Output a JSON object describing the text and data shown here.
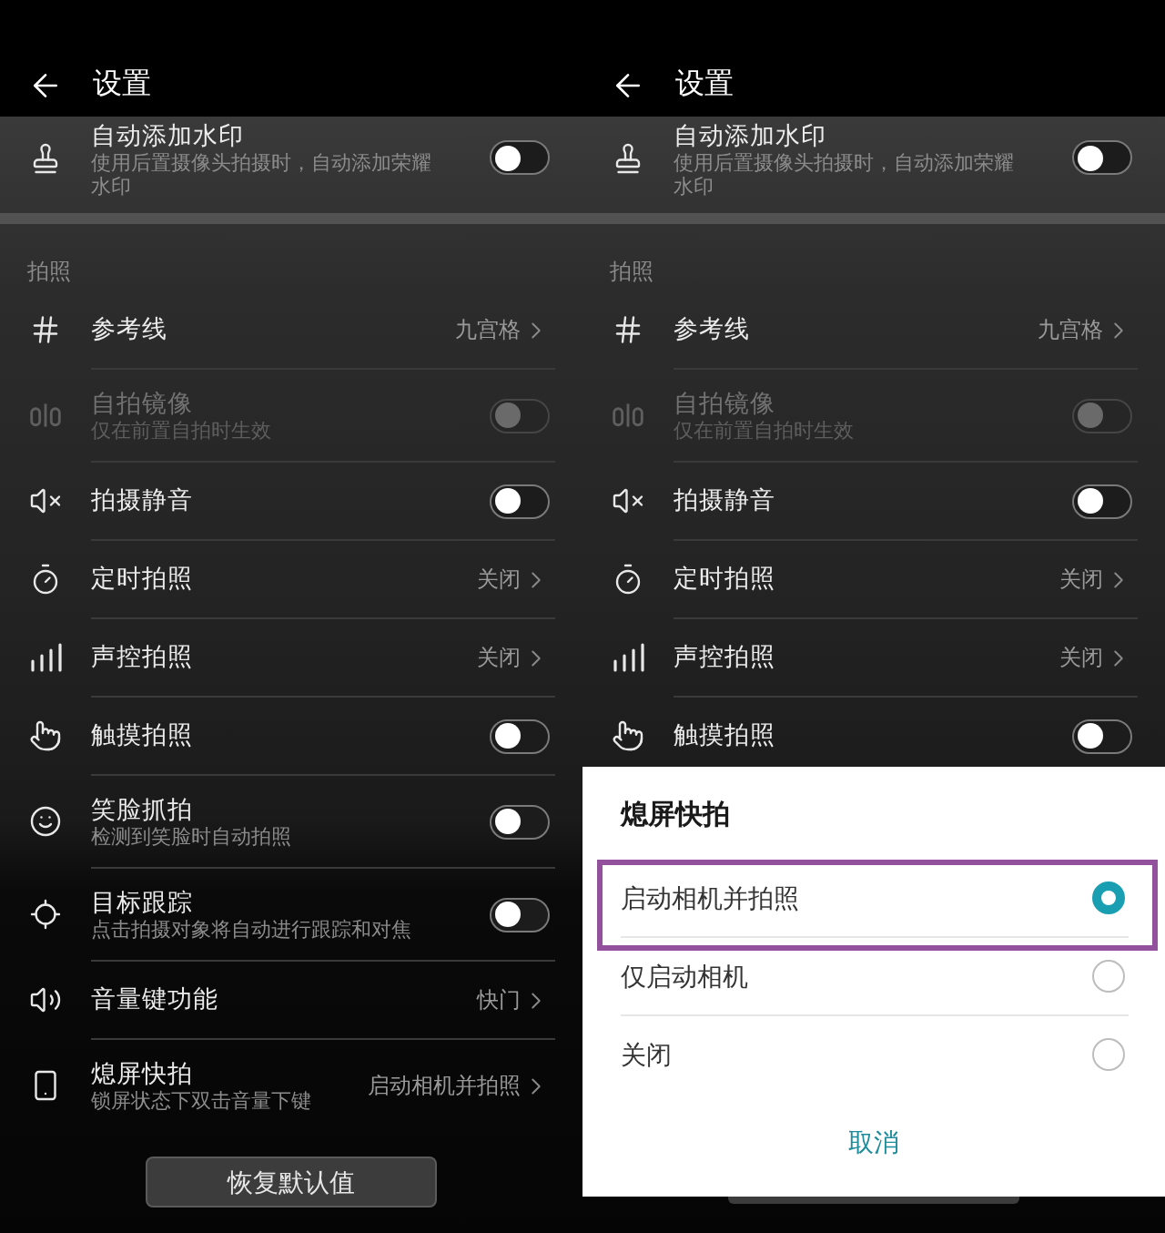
{
  "screens": [
    {
      "header": {
        "title": "设置"
      },
      "top_item": {
        "kind": "toggle",
        "title": "自动添加水印",
        "subtitle": "使用后置摄像头拍摄时，自动添加荣耀水印",
        "on": false,
        "disabled": false
      },
      "section": {
        "title": "拍照",
        "items": [
          {
            "kind": "link",
            "title": "参考线",
            "value": "九宫格",
            "disabled": false
          },
          {
            "kind": "toggle",
            "title": "自拍镜像",
            "subtitle": "仅在前置自拍时生效",
            "on": false,
            "disabled": true
          },
          {
            "kind": "toggle",
            "title": "拍摄静音",
            "on": false,
            "disabled": false
          },
          {
            "kind": "link",
            "title": "定时拍照",
            "value": "关闭",
            "disabled": false
          },
          {
            "kind": "link",
            "title": "声控拍照",
            "value": "关闭",
            "disabled": false
          },
          {
            "kind": "toggle",
            "title": "触摸拍照",
            "on": false,
            "disabled": false
          },
          {
            "kind": "toggle",
            "title": "笑脸抓拍",
            "subtitle": "检测到笑脸时自动拍照",
            "on": false,
            "disabled": false
          },
          {
            "kind": "toggle",
            "title": "目标跟踪",
            "subtitle": "点击拍摄对象将自动进行跟踪和对焦",
            "on": false,
            "disabled": false
          },
          {
            "kind": "link",
            "title": "音量键功能",
            "value": "快门",
            "disabled": false
          },
          {
            "kind": "link",
            "title": "熄屏快拍",
            "subtitle": "锁屏状态下双击音量下键",
            "value": "启动相机并拍照",
            "disabled": false
          }
        ]
      },
      "reset_button": "恢复默认值"
    },
    {
      "header": {
        "title": "设置"
      },
      "top_item": {
        "kind": "toggle",
        "title": "自动添加水印",
        "subtitle": "使用后置摄像头拍摄时，自动添加荣耀水印",
        "on": false,
        "disabled": false
      },
      "section": {
        "title": "拍照",
        "items": [
          {
            "kind": "link",
            "title": "参考线",
            "value": "九宫格",
            "disabled": false
          },
          {
            "kind": "toggle",
            "title": "自拍镜像",
            "subtitle": "仅在前置自拍时生效",
            "on": false,
            "disabled": true
          },
          {
            "kind": "toggle",
            "title": "拍摄静音",
            "on": false,
            "disabled": false
          },
          {
            "kind": "link",
            "title": "定时拍照",
            "value": "关闭",
            "disabled": false
          },
          {
            "kind": "link",
            "title": "声控拍照",
            "value": "关闭",
            "disabled": false
          },
          {
            "kind": "toggle",
            "title": "触摸拍照",
            "on": false,
            "disabled": false
          }
        ]
      },
      "dialog": {
        "title": "熄屏快拍",
        "options": [
          {
            "label": "启动相机并拍照",
            "selected": true,
            "highlighted": true
          },
          {
            "label": "仅启动相机",
            "selected": false,
            "highlighted": false
          },
          {
            "label": "关闭",
            "selected": false,
            "highlighted": false
          }
        ],
        "cancel": "取消"
      }
    }
  ]
}
